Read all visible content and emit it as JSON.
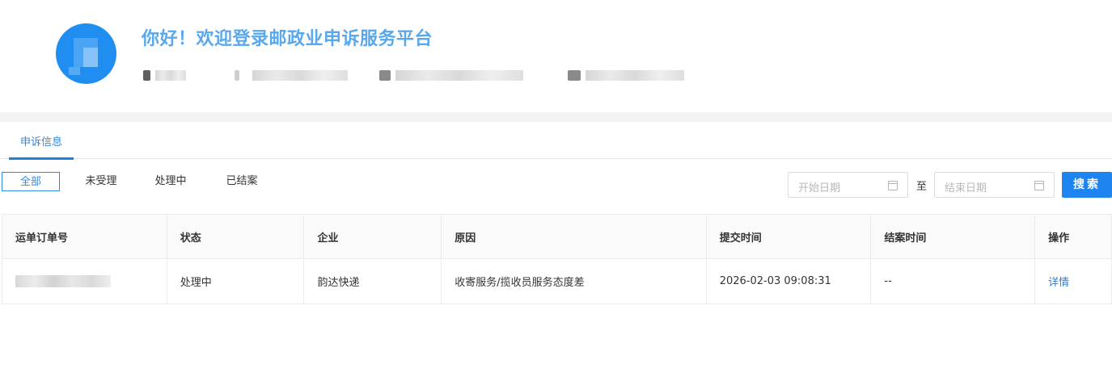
{
  "header": {
    "welcome": "你好！欢迎登录邮政业申诉服务平台"
  },
  "tabs": [
    {
      "label": "申诉信息",
      "active": true
    }
  ],
  "filters": {
    "status_buttons": [
      {
        "label": "全部",
        "active": true
      },
      {
        "label": "未受理",
        "active": false
      },
      {
        "label": "处理中",
        "active": false
      },
      {
        "label": "已结案",
        "active": false
      }
    ],
    "start_placeholder": "开始日期",
    "to_label": "至",
    "end_placeholder": "结束日期",
    "search_label": "搜索"
  },
  "table": {
    "columns": [
      "运单订单号",
      "状态",
      "企业",
      "原因",
      "提交时间",
      "结案时间",
      "操作"
    ],
    "rows": [
      {
        "status": "处理中",
        "company": "韵达快递",
        "reason": "收寄服务/揽收员服务态度差",
        "submit_time": "2026-02-03 09:08:31",
        "close_time": "--",
        "action": "详情"
      }
    ]
  },
  "colors": {
    "accent": "#1d84f0",
    "welcome_text": "#5aa8ec",
    "link": "#2f7fd0"
  }
}
